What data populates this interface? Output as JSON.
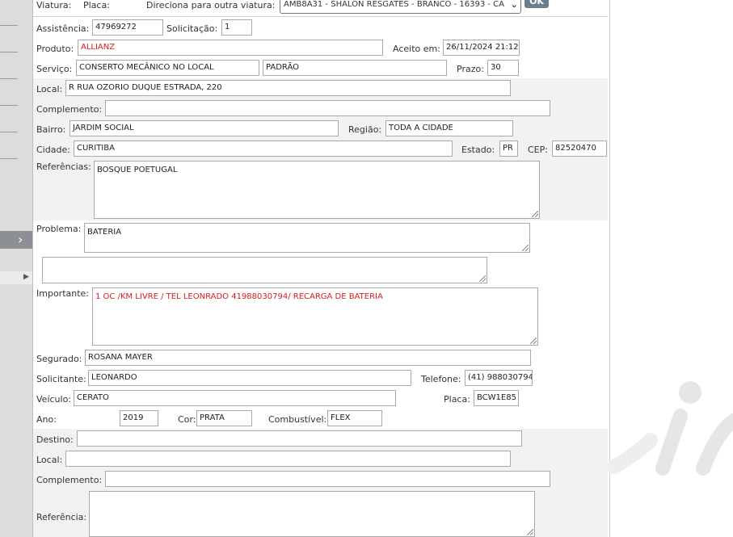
{
  "header": {
    "viatura_label": "Viatura:",
    "placa_label": "Placa:",
    "direciona_label": "Direciona para outra viatura:",
    "vehicle_selected": "AMB8A31 - SHALON RESGATES - BRANCO - 16393 - CA",
    "ok_label": "OK"
  },
  "service": {
    "assistencia_label": "Assistência:",
    "assistencia": "47969272",
    "solicitacao_label": "Solicitação:",
    "solicitacao": "1",
    "produto_label": "Produto:",
    "produto": "ALLIANZ",
    "aceito_label": "Aceito em:",
    "aceito": "26/11/2024 21:12",
    "servico_label": "Serviço:",
    "servico": "CONSERTO MECÂNICO NO LOCAL",
    "servico_tipo": "PADRÃO",
    "prazo_label": "Prazo:",
    "prazo": "30"
  },
  "origin": {
    "local_label": "Local:",
    "local": "R RUA OZORIO DUQUE ESTRADA, 220",
    "complemento_label": "Complemento:",
    "complemento": "",
    "bairro_label": "Bairro:",
    "bairro": "JARDIM SOCIAL",
    "regiao_label": "Região:",
    "regiao": "TODA A CIDADE",
    "cidade_label": "Cidade:",
    "cidade": "CURITIBA",
    "estado_label": "Estado:",
    "estado": "PR",
    "cep_label": "CEP:",
    "cep": "82520470",
    "referencias_label": "Referências:",
    "referencias": "BOSQUE POETUGAL"
  },
  "details": {
    "problema_label": "Problema:",
    "problema": "BATERIA",
    "extra": "",
    "importante_label": "Importante:",
    "importante": "1 OC /KM LIVRE / TEL LEONRADO 41988030794/ RECARGA DE BATERIA",
    "segurado_label": "Segurado:",
    "segurado": "ROSANA MAYER",
    "solicitante_label": "Solicitante:",
    "solicitante": "LEONARDO",
    "telefone_label": "Telefone:",
    "telefone": "(41) 988030794",
    "veiculo_label": "Veículo:",
    "veiculo": "CERATO",
    "placa_label": "Placa:",
    "placa": "BCW1E85",
    "ano_label": "Ano:",
    "ano": "2019",
    "cor_label": "Cor:",
    "cor": "PRATA",
    "combustivel_label": "Combustível:",
    "combustivel": "FLEX"
  },
  "destination": {
    "destino_label": "Destino:",
    "destino": "",
    "local_label": "Local:",
    "local": "",
    "complemento_label": "Complemento:",
    "complemento": "",
    "referencia_label": "Referência:",
    "referencia": ""
  },
  "colors": {
    "accent_red": "#d32020",
    "band_gray": "#f2f2f2",
    "sidebar_gray": "#dcdcdc"
  }
}
